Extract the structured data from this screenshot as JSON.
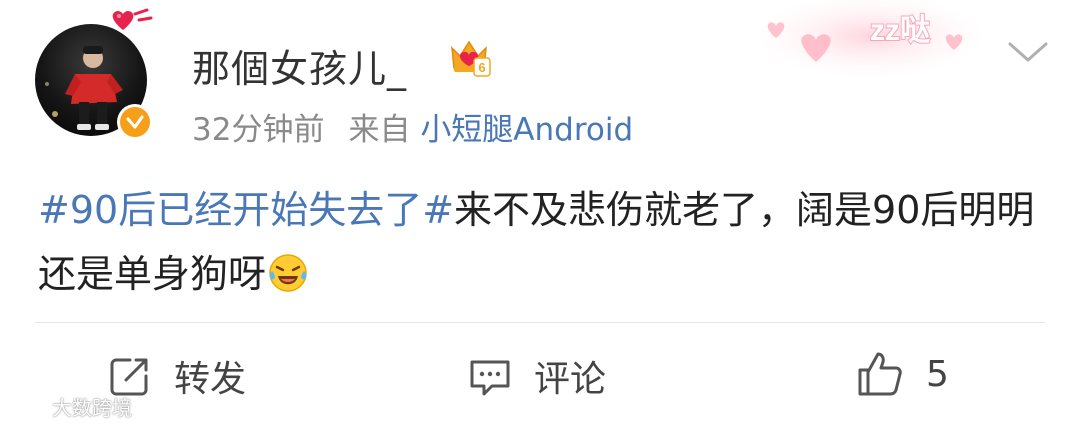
{
  "post": {
    "author": {
      "name": "那個女孩儿_",
      "vip_level": "6",
      "verified": true
    },
    "meta": {
      "time": "32分钟前",
      "from_label": "来自",
      "source": "小短腿Android"
    },
    "sticker_text": "zz哒",
    "body": {
      "topic": "#90后已经开始失去了#",
      "text": "来不及悲伤就老了，阔是90后明明还是单身狗呀",
      "emoji": "laughing-tears-emoji"
    },
    "actions": {
      "repost_label": "转发",
      "comment_label": "评论",
      "like_count": "5"
    },
    "watermark": "大数跨境"
  },
  "colors": {
    "link_blue": "#4a78b6",
    "text": "#222222",
    "meta_gray": "#8a8a8a",
    "badge_orange": "#f6a01a"
  }
}
